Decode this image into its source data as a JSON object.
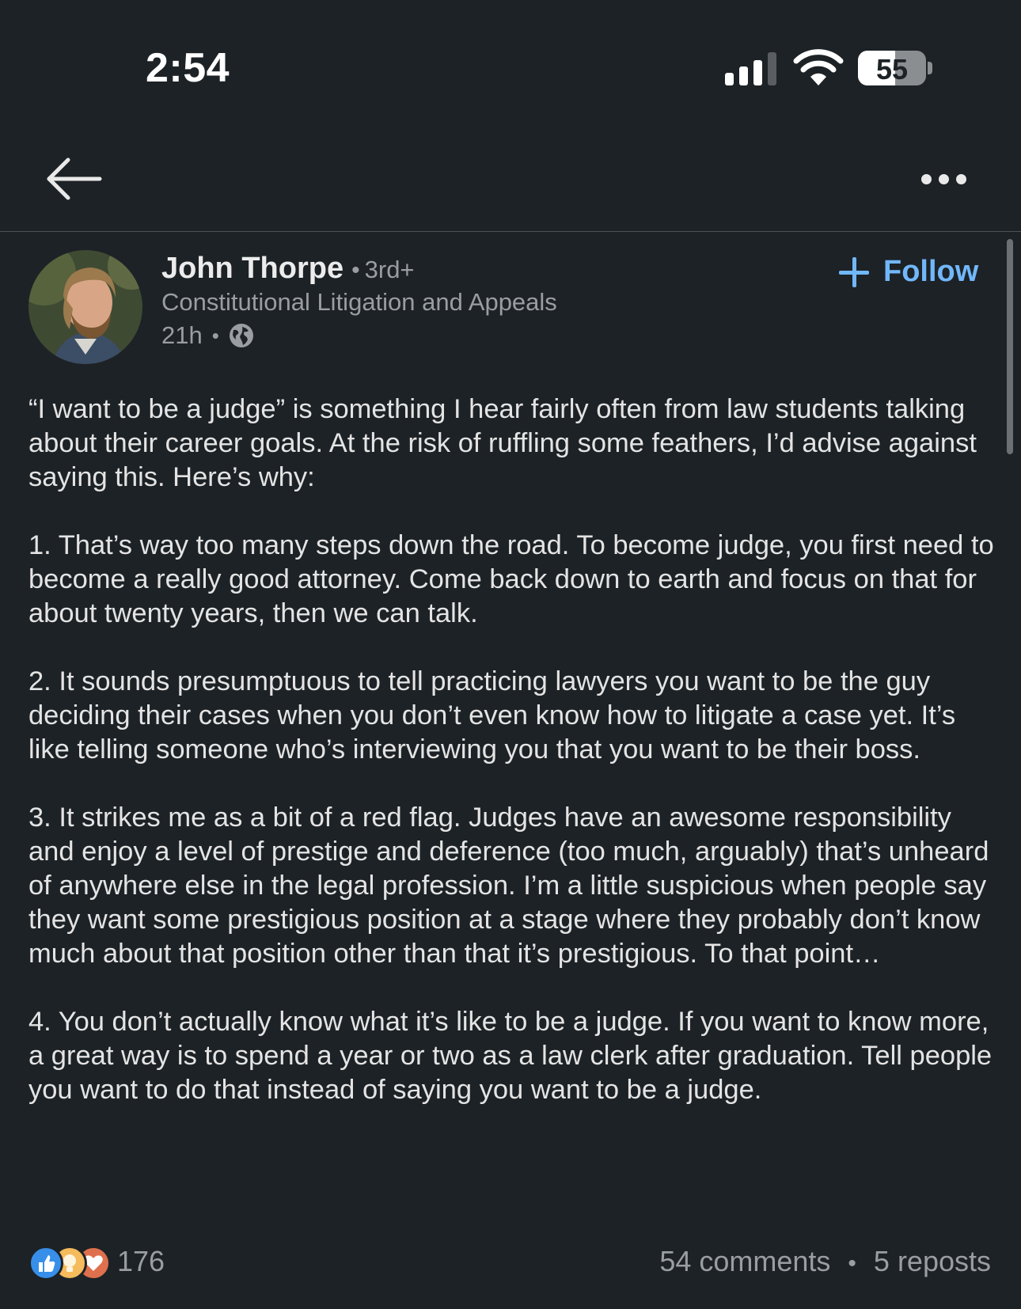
{
  "status_bar": {
    "time": "2:54",
    "battery_level": "55",
    "battery_fraction": 0.55
  },
  "nav": {
    "back_icon": "arrow-left-icon",
    "more_icon": "ellipsis-horizontal-icon"
  },
  "post": {
    "author": {
      "name": "John Thorpe",
      "separator": "•",
      "degree": "3rd+",
      "headline": "Constitutional Litigation and Appeals"
    },
    "time": "21h",
    "meta_separator": "•",
    "visibility_icon": "globe-icon",
    "follow_label": "Follow",
    "paragraphs": [
      "“I want to be a judge” is something I hear fairly often from law students talking about their career goals. At the risk of ruffling some feathers, I’d advise against saying this. Here’s why:",
      "1. That’s way too many steps down the road. To become judge, you first need to become a really good attorney. Come back down to earth and focus on that for about twenty years, then we can talk.",
      "2. It sounds presumptuous to tell practicing lawyers you want to be the guy deciding their cases when you don’t even know how to litigate a case yet. It’s like telling someone who’s interviewing you that you want to be their boss.",
      "3. It strikes me as a bit of a red flag. Judges have an awesome responsibility and enjoy a level of prestige and deference (too much, arguably) that’s unheard of anywhere else in the legal profession. I’m a little suspicious when people say they want some prestigious position at a stage where they probably don’t know much about that position other than that it’s prestigious. To that point…",
      "4. You don’t actually know what it’s like to be a judge. If you want to know more, a great way is to spend a year or two as a law clerk after graduation. Tell people you want to do that instead of saying you want to be a judge."
    ],
    "social": {
      "reaction_icons": [
        "like-icon",
        "insightful-icon",
        "love-icon"
      ],
      "reaction_count": "176",
      "comments": "54 comments",
      "separator": "•",
      "reposts": "5 reposts"
    }
  },
  "colors": {
    "background": "#1d2226",
    "accent": "#71b7fb",
    "muted_text": "#9a9ea3",
    "body_text": "#e4e4e4"
  }
}
